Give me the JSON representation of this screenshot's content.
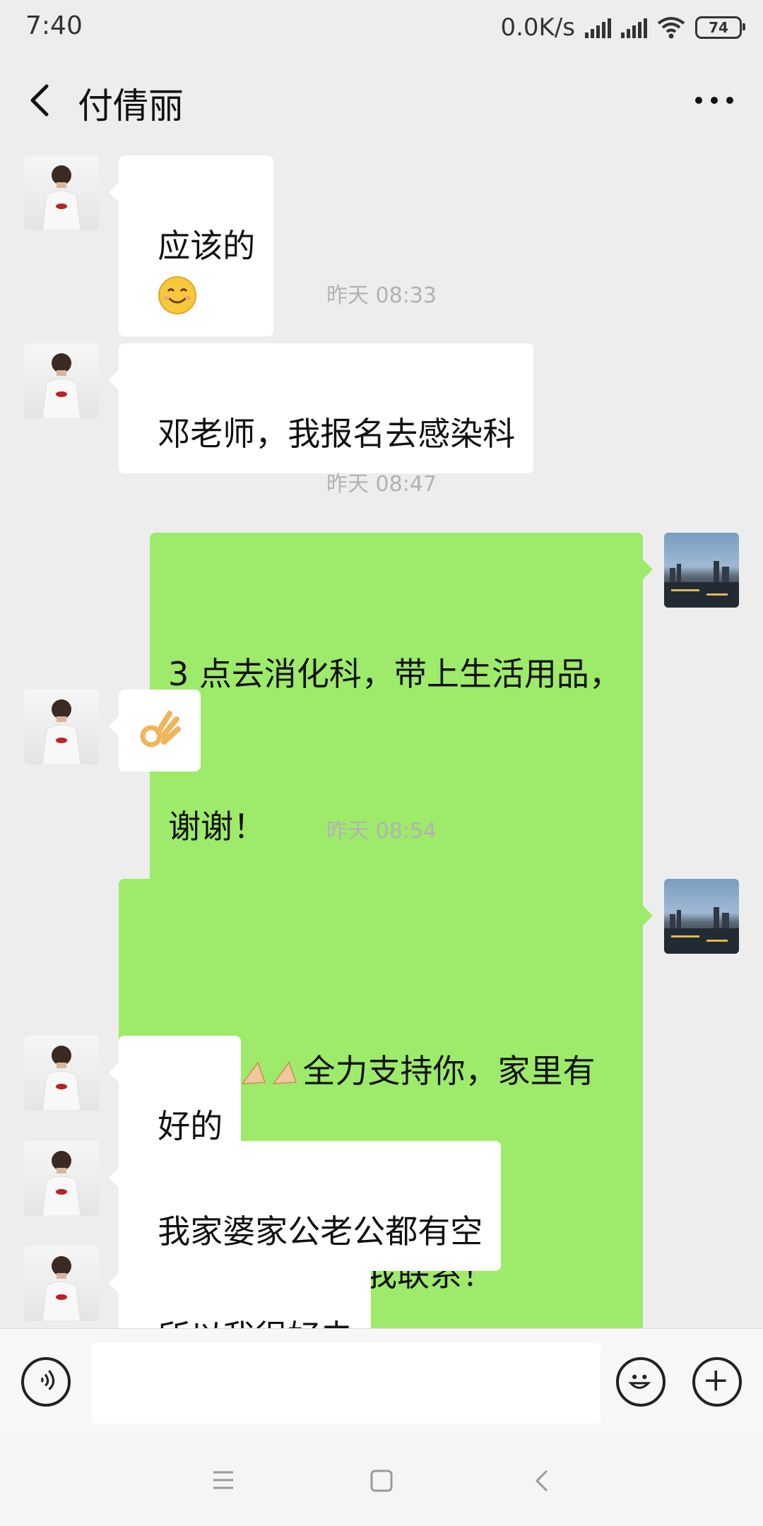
{
  "status_bar": {
    "time": "7:40",
    "net_speed": "0.0K/s",
    "battery": "74"
  },
  "header": {
    "title": "付倩丽",
    "back_icon": "chevron-left-icon",
    "more_icon": "more-dots-icon"
  },
  "messages": [
    {
      "side": "in",
      "text": "应该的"
    },
    {
      "type": "timestamp",
      "text": "昨天 08:33"
    },
    {
      "side": "in",
      "text": "邓老师，我报名去感染科"
    },
    {
      "type": "timestamp",
      "text": "昨天 08:47"
    },
    {
      "side": "out",
      "line1": "3 点去消化科，带上生活用品，",
      "line2": "谢谢！"
    },
    {
      "side": "in",
      "text": "",
      "emoji": "ok-hand"
    },
    {
      "type": "timestamp",
      "text": "昨天 08:54"
    },
    {
      "side": "out",
      "line1": "全力支持你，家里有",
      "line2": "什么需要随时与我联系！",
      "emoji": "muscle, muscle, pray, pray"
    },
    {
      "side": "in",
      "text": "好的"
    },
    {
      "side": "in",
      "text": "我家婆家公老公都有空"
    },
    {
      "side": "in",
      "text": "所以我很好去"
    }
  ],
  "input_bar": {
    "voice_icon": "voice-icon",
    "emoji_icon": "emoji-icon",
    "plus_icon": "plus-icon",
    "placeholder": ""
  },
  "nav_bar": {
    "menu_icon": "menu-icon",
    "home_icon": "home-square-icon",
    "back_icon": "back-triangle-icon"
  },
  "colors": {
    "background": "#ededed",
    "incoming_bubble": "#ffffff",
    "outgoing_bubble": "#9eea6a",
    "timestamp_text": "#b2b2b2"
  }
}
